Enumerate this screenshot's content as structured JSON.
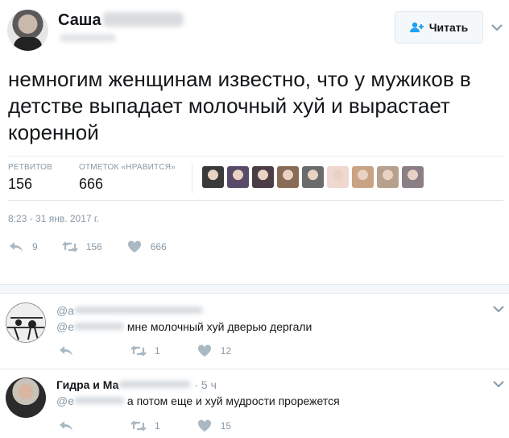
{
  "tweet": {
    "author_name": "Саша",
    "follow_label": "Читать",
    "text": "немногим женщинам известно, что у мужиков в детстве выпадает молочный хуй и вырастает коренной",
    "retweets_label": "РЕТВИТОВ",
    "retweets_count": "156",
    "likes_label": "ОТМЕТОК «НРАВИТСЯ»",
    "likes_count": "666",
    "timestamp": "8:23 - 31 янв. 2017 г.",
    "actions": {
      "reply_count": "9",
      "retweet_count": "156",
      "like_count": "666"
    },
    "liker_avatars": [
      "#3a3a3a",
      "#5a4a6a",
      "#4b3d45",
      "#8a6b55",
      "#6b6b6b",
      "#f0d7d0",
      "#c9a383",
      "#b7a18c",
      "#8b7e86"
    ]
  },
  "replies": [
    {
      "handle_prefix": "@a",
      "mention_prefix": "@e",
      "text": "мне молочный хуй дверью дергали",
      "retweet_count": "1",
      "like_count": "12"
    },
    {
      "name": "Гидра и Ма",
      "time": "5 ч",
      "mention_prefix": "@e",
      "text": "а потом еще и хуй мудрости прорежется",
      "retweet_count": "1",
      "like_count": "15"
    }
  ],
  "colors": {
    "secondary_text": "#8899a6",
    "border": "#e1e8ed",
    "text": "#14171a"
  }
}
